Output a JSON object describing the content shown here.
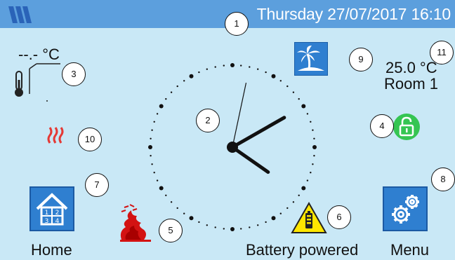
{
  "topbar": {
    "logo_icon": "brand-logo-icon",
    "datetime": "Thursday 27/07/2017  16:10",
    "text_color": "#ffffff",
    "background": "#5c9fdd"
  },
  "screen": {
    "background": "#c9e8f6"
  },
  "outdoor": {
    "temperature": "--.- °C",
    "icon": "thermometer-icon"
  },
  "room": {
    "temperature": "25.0 °C",
    "name": "Room 1"
  },
  "status_icons": {
    "heating": "heating-waves-icon",
    "holiday": "palm-island-icon",
    "lock": "unlocked-padlock-icon",
    "flame": "flame-icon",
    "battery": "battery-warning-icon"
  },
  "clock": {
    "hour": 16,
    "minute": 10,
    "second": 2
  },
  "home": {
    "label": "Home",
    "icon": "house-zones-icon"
  },
  "menu": {
    "label": "Menu",
    "icon": "gears-icon"
  },
  "battery": {
    "label": "Battery powered"
  },
  "callouts": [
    "1",
    "2",
    "3",
    "4",
    "5",
    "6",
    "7",
    "8",
    "9",
    "10",
    "11"
  ],
  "colors": {
    "accent": "#2f7fd0",
    "lock_green": "#35c552",
    "heating_red": "#e53935",
    "battery_yellow": "#ffe600"
  }
}
